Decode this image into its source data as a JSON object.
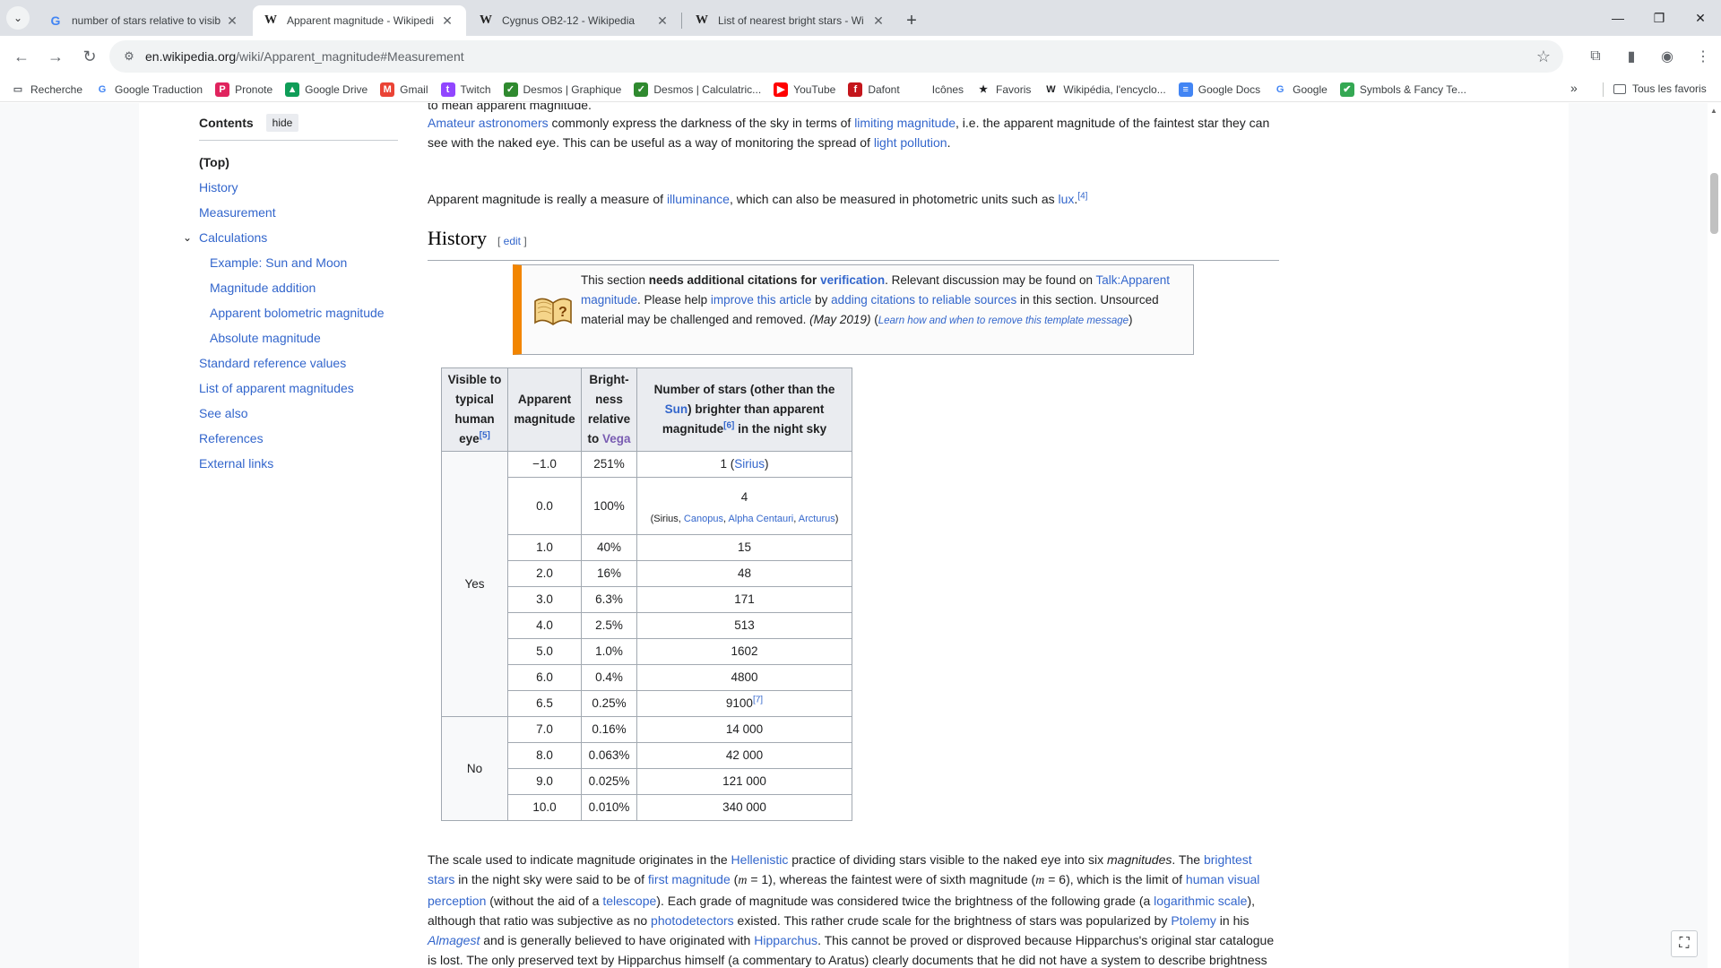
{
  "browser": {
    "tabs": [
      {
        "title": "number of stars relative to visib",
        "icon": "google-icon",
        "active": false
      },
      {
        "title": "Apparent magnitude - Wikipedi",
        "icon": "wikipedia-icon",
        "active": true
      },
      {
        "title": "Cygnus OB2-12 - Wikipedia",
        "icon": "wikipedia-icon",
        "active": false
      },
      {
        "title": "List of nearest bright stars - Wi",
        "icon": "wikipedia-icon",
        "active": false
      }
    ],
    "url_host": "en.wikipedia.org",
    "url_path": "/wiki/Apparent_magnitude#Measurement",
    "bookmarks": [
      {
        "label": "Recherche",
        "icon": "folder-icon",
        "color": "#5f6368"
      },
      {
        "label": "Google Traduction",
        "icon": "translate-icon",
        "color": "#4285f4"
      },
      {
        "label": "Pronote",
        "icon": "pronote-icon",
        "color": "#e0245e"
      },
      {
        "label": "Google Drive",
        "icon": "drive-icon",
        "color": "#0f9d58"
      },
      {
        "label": "Gmail",
        "icon": "gmail-icon",
        "color": "#ea4335"
      },
      {
        "label": "Twitch",
        "icon": "twitch-icon",
        "color": "#9146ff"
      },
      {
        "label": "Desmos | Graphique",
        "icon": "desmos-icon",
        "color": "#2f8a2f"
      },
      {
        "label": "Desmos | Calculatric...",
        "icon": "desmos-icon",
        "color": "#2f8a2f"
      },
      {
        "label": "YouTube",
        "icon": "youtube-icon",
        "color": "#ff0000"
      },
      {
        "label": "Dafont",
        "icon": "dafont-icon",
        "color": "#c4161c"
      },
      {
        "label": "Icônes",
        "icon": "icons-icon",
        "color": "#ffffff"
      },
      {
        "label": "Favoris",
        "icon": "star-icon",
        "color": "#202124"
      },
      {
        "label": "Wikipédia, l'encyclo...",
        "icon": "wikipedia-icon",
        "color": "#202124"
      },
      {
        "label": "Google Docs",
        "icon": "docs-icon",
        "color": "#4285f4"
      },
      {
        "label": "Google",
        "icon": "google-icon",
        "color": "#4285f4"
      },
      {
        "label": "Symbols & Fancy Te...",
        "icon": "check-icon",
        "color": "#34a853"
      }
    ],
    "all_bookmarks": "Tous les favoris"
  },
  "toc": {
    "title": "Contents",
    "hide": "hide",
    "items": [
      {
        "label": "(Top)",
        "level": 0
      },
      {
        "label": "History",
        "level": 0
      },
      {
        "label": "Measurement",
        "level": 0
      },
      {
        "label": "Calculations",
        "level": 0
      },
      {
        "label": "Example: Sun and Moon",
        "level": 1
      },
      {
        "label": "Magnitude addition",
        "level": 1
      },
      {
        "label": "Apparent bolometric magnitude",
        "level": 1
      },
      {
        "label": "Absolute magnitude",
        "level": 1
      },
      {
        "label": "Standard reference values",
        "level": 0
      },
      {
        "label": "List of apparent magnitudes",
        "level": 0
      },
      {
        "label": "See also",
        "level": 0
      },
      {
        "label": "References",
        "level": 0
      },
      {
        "label": "External links",
        "level": 0
      }
    ]
  },
  "article": {
    "p0": "to mean apparent magnitude.",
    "p1": {
      "a1": "Amateur astronomers",
      "t1": " commonly express the darkness of the sky in terms of ",
      "a2": "limiting magnitude",
      "t2": ", i.e. the apparent magnitude of the faintest star they can see with the naked eye. This can be useful as a way of monitoring the spread of ",
      "a3": "light pollution",
      "t3": "."
    },
    "p2": {
      "t1": "Apparent magnitude is really a measure of ",
      "a1": "illuminance",
      "t2": ", which can also be measured in photometric units such as ",
      "a2": "lux",
      "t3": ".",
      "ref": "[4]"
    },
    "history_heading": "History",
    "edit": "edit",
    "notice": {
      "t1": "This section ",
      "b1": "needs additional citations for ",
      "a1": "verification",
      "t2": ". Relevant discussion may be found on ",
      "a2": "Talk:Apparent magnitude",
      "t3": ". Please help ",
      "a3": "improve this article",
      "t4": " by ",
      "a4": "adding citations to reliable sources",
      "t5": " in this section. Unsourced material may be challenged and removed. ",
      "date": "(May 2019)",
      "t6": " (",
      "a5": "Learn how and when to remove this template message",
      "t7": ")"
    },
    "table": {
      "headers": {
        "visible": "Visible to typical human eye",
        "visible_ref": "[5]",
        "mag": "Apparent magnitude",
        "bright_1": "Bright­ness relative to ",
        "bright_vega": "Vega",
        "num_1": "Number of stars (other than the ",
        "num_sun": "Sun",
        "num_2": ") brighter than apparent magnitude",
        "num_ref": "[6]",
        "num_3": " in the night sky"
      },
      "yes": "Yes",
      "no": "No",
      "rows": [
        {
          "mag": "−1.0",
          "bright": "251%",
          "count": "1",
          "note": "Sirius"
        },
        {
          "mag": "0.0",
          "bright": "100%",
          "count": "4",
          "note_parts": [
            "Sirius",
            "Canopus",
            "Alpha Centauri",
            "Arcturus"
          ]
        },
        {
          "mag": "1.0",
          "bright": "40%",
          "count": "15"
        },
        {
          "mag": "2.0",
          "bright": "16%",
          "count": "48"
        },
        {
          "mag": "3.0",
          "bright": "6.3%",
          "count": "171"
        },
        {
          "mag": "4.0",
          "bright": "2.5%",
          "count": "513"
        },
        {
          "mag": "5.0",
          "bright": "1.0%",
          "count": "1602"
        },
        {
          "mag": "6.0",
          "bright": "0.4%",
          "count": "4800"
        },
        {
          "mag": "6.5",
          "bright": "0.25%",
          "count": "9100",
          "ref": "[7]"
        },
        {
          "mag": "7.0",
          "bright": "0.16%",
          "count": "14 000"
        },
        {
          "mag": "8.0",
          "bright": "0.063%",
          "count": "42 000"
        },
        {
          "mag": "9.0",
          "bright": "0.025%",
          "count": "121 000"
        },
        {
          "mag": "10.0",
          "bright": "0.010%",
          "count": "340 000"
        }
      ]
    },
    "p3": {
      "t1": "The scale used to indicate magnitude originates in the ",
      "a1": "Hellenistic",
      "t2": " practice of dividing stars visible to the naked eye into six ",
      "i1": "magnitudes",
      "t3": ". The ",
      "a2": "brightest stars",
      "t4": " in the night sky were said to be of ",
      "a3": "first magnitude",
      "t5": " (",
      "m1": "m",
      "t6": " = 1), whereas the faintest were of sixth magnitude (",
      "m2": "m",
      "t7": " = 6), which is the limit of ",
      "a4": "human visual perception",
      "t8": " (without the aid of a ",
      "a5": "telescope",
      "t9": "). Each grade of magnitude was considered twice the brightness of the following grade (a ",
      "a6": "logarithmic scale",
      "t10": "), although that ratio was subjective as no ",
      "a7": "photodetectors",
      "t11": " existed. This rather crude scale for the brightness of stars was popularized by ",
      "a8": "Ptolemy",
      "t12": " in his ",
      "i2": "Almagest",
      "t13": " and is generally believed to have originated with ",
      "a9": "Hipparchus",
      "t14": ". This cannot be proved or disproved because Hipparchus's original star catalogue is lost. The only preserved text by Hipparchus himself (a commentary to Aratus) clearly documents that he did not have a system to describe brightness"
    }
  }
}
